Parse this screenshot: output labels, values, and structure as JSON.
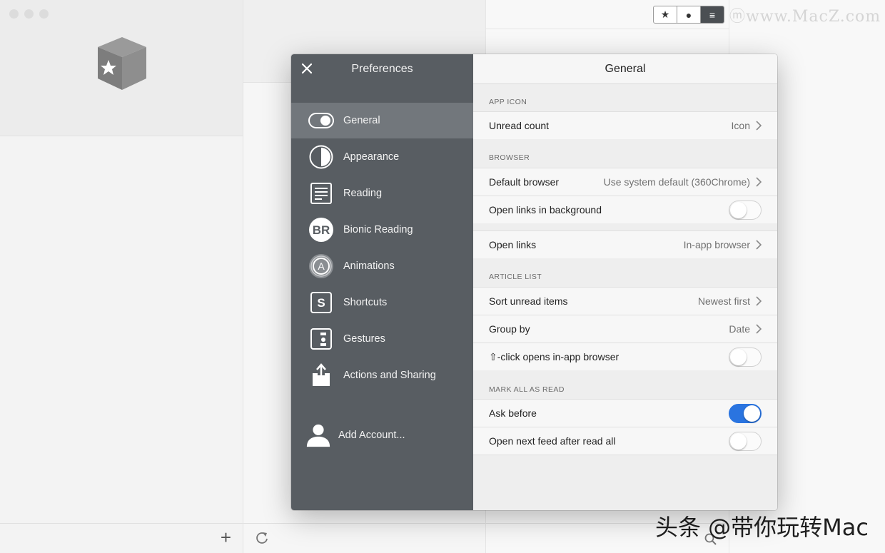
{
  "background": {
    "segmented": [
      "★",
      "●",
      "≡"
    ],
    "watermark": "ⓜwww.MacZ.com",
    "watermark_cn": "头条 @带你玩转Mac"
  },
  "colors": {
    "sidebar_bg": "#585d62",
    "sidebar_active": "#72777c",
    "toggle_on": "#2a74e0"
  },
  "sidebar": {
    "title": "Preferences",
    "items": [
      {
        "label": "General",
        "icon": "toggle-icon",
        "active": true
      },
      {
        "label": "Appearance",
        "icon": "half-circle-icon"
      },
      {
        "label": "Reading",
        "icon": "document-lines-icon"
      },
      {
        "label": "Bionic Reading",
        "icon": "br-badge-icon"
      },
      {
        "label": "Animations",
        "icon": "animation-a-icon"
      },
      {
        "label": "Shortcuts",
        "icon": "shortcut-s-icon"
      },
      {
        "label": "Gestures",
        "icon": "gestures-icon"
      },
      {
        "label": "Actions and Sharing",
        "icon": "share-icon"
      }
    ],
    "add_account": "Add Account..."
  },
  "content": {
    "title": "General",
    "sections": {
      "app_icon": "APP ICON",
      "browser": "BROWSER",
      "article_list": "ARTICLE LIST",
      "mark_all": "MARK ALL AS READ"
    },
    "rows": {
      "unread_count": {
        "label": "Unread count",
        "value": "Icon"
      },
      "default_browser": {
        "label": "Default browser",
        "value": "Use system default (360Chrome)"
      },
      "open_links_background": {
        "label": "Open links in background",
        "on": false
      },
      "open_links": {
        "label": "Open links",
        "value": "In-app browser"
      },
      "sort_unread": {
        "label": "Sort unread items",
        "value": "Newest first"
      },
      "group_by": {
        "label": "Group by",
        "value": "Date"
      },
      "shift_click": {
        "label": "⇧-click opens in-app browser",
        "on": false
      },
      "ask_before": {
        "label": "Ask before",
        "on": true
      },
      "open_next_feed": {
        "label": "Open next feed after read all",
        "on": false
      }
    }
  }
}
